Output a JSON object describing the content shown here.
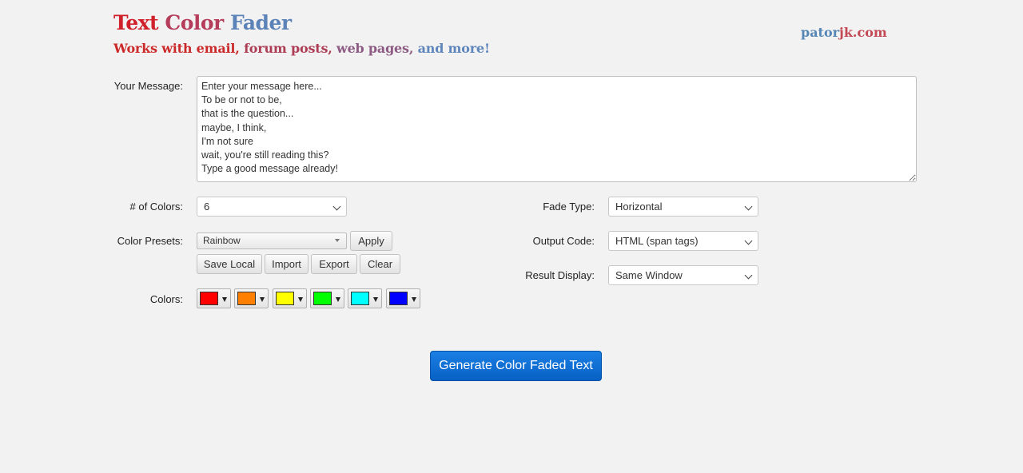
{
  "header": {
    "title_words": [
      {
        "text": "Text",
        "color": "#d0212b"
      },
      {
        "text": "Color",
        "color": "#b53c5a"
      },
      {
        "text": "Fader",
        "color": "#5c83b8"
      }
    ],
    "subtitle_parts": [
      {
        "text": "Works with email, ",
        "color": "#cc2a2a"
      },
      {
        "text": "forum posts, ",
        "color": "#ad3d55"
      },
      {
        "text": "web pages, ",
        "color": "#8c5a82"
      },
      {
        "text": "and more!",
        "color": "#5f86bb"
      }
    ],
    "site_parts": [
      {
        "text": "pator",
        "color": "#5586b5"
      },
      {
        "text": "jk.com",
        "color": "#c24955"
      }
    ]
  },
  "form": {
    "message_label": "Your Message:",
    "message_value": "Enter your message here...\nTo be or not to be,\nthat is the question...\nmaybe, I think,\nI'm not sure\nwait, you're still reading this?\nType a good message already!",
    "num_colors_label": "# of Colors:",
    "num_colors_value": "6",
    "presets_label": "Color Presets:",
    "preset_value": "Rainbow",
    "apply_label": "Apply",
    "save_local_label": "Save Local",
    "import_label": "Import",
    "export_label": "Export",
    "clear_label": "Clear",
    "colors_label": "Colors:",
    "colors": [
      "#ff0000",
      "#ff8000",
      "#ffff00",
      "#00ff00",
      "#00ffff",
      "#0000ff"
    ],
    "fade_type_label": "Fade Type:",
    "fade_type_value": "Horizontal",
    "output_code_label": "Output Code:",
    "output_code_value": "HTML (span tags)",
    "result_display_label": "Result Display:",
    "result_display_value": "Same Window"
  },
  "generate_label": "Generate Color Faded Text"
}
